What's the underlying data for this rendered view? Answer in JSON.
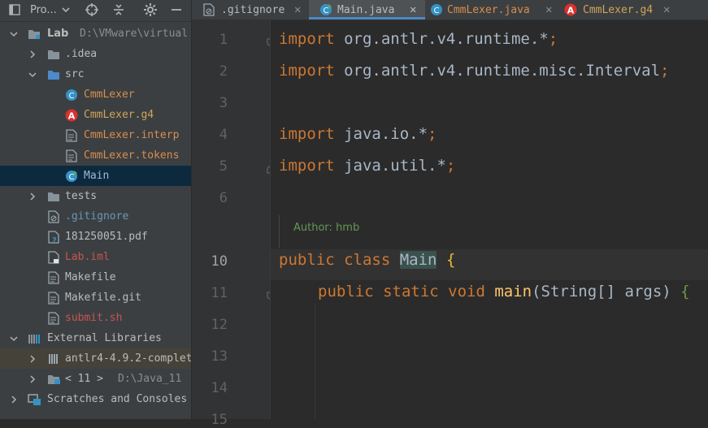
{
  "project_panel": {
    "toolbar": {
      "title": "Pro..."
    },
    "tree": [
      {
        "name": "Lab",
        "path": "D:\\VMware\\virtual"
      },
      {
        "name": ".idea"
      },
      {
        "name": "src"
      },
      {
        "name": "CmmLexer"
      },
      {
        "name": "CmmLexer.g4"
      },
      {
        "name": "CmmLexer.interp"
      },
      {
        "name": "CmmLexer.tokens"
      },
      {
        "name": "Main"
      },
      {
        "name": "tests"
      },
      {
        "name": ".gitignore"
      },
      {
        "name": "181250051.pdf"
      },
      {
        "name": "Lab.iml"
      },
      {
        "name": "Makefile"
      },
      {
        "name": "Makefile.git"
      },
      {
        "name": "submit.sh"
      },
      {
        "name": "External Libraries"
      },
      {
        "name": "antlr4-4.9.2-complet"
      },
      {
        "name": "< 11 >",
        "path": "D:\\Java_11"
      },
      {
        "name": "Scratches and Consoles"
      }
    ]
  },
  "tabs": [
    {
      "label": ".gitignore",
      "active": false
    },
    {
      "label": "Main.java",
      "active": true
    },
    {
      "label": "CmmLexer.java",
      "active": false
    },
    {
      "label": "CmmLexer.g4",
      "active": false
    }
  ],
  "gutter": {
    "line_numbers": [
      "1",
      "2",
      "3",
      "4",
      "5",
      "6",
      "10",
      "11",
      "12",
      "13",
      "14",
      "15"
    ]
  },
  "code": {
    "l1_kw": "import",
    "l1_rest": " org.antlr.v4.runtime.*",
    "l2_kw": "import",
    "l2_rest": " org.antlr.v4.runtime.misc.Interval",
    "l4_kw": "import",
    "l4_rest": " java.io.*",
    "l5_kw": "import",
    "l5_rest": " java.util.*",
    "semicolon": ";",
    "author_label": "Author:",
    "author_value": "hmb",
    "l10_mod": "public class ",
    "l10_name": "Main",
    "l10_brace": "{",
    "l11_mod": "public static void ",
    "l11_fn": "main",
    "l11_params": "(String[] args) ",
    "l11_brace": "{"
  },
  "colors": {
    "keyword": "#cc7832",
    "function": "#ffc66d",
    "comment": "#629755",
    "accent": "#4a88c7"
  }
}
